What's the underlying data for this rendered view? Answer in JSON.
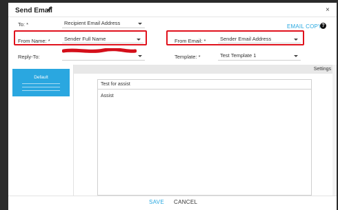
{
  "modal": {
    "title": "Send Email",
    "close_glyph": "×",
    "edit_icon": "pencil-icon"
  },
  "fields": {
    "to": {
      "label": "To: *",
      "value": "Recipient Email Address"
    },
    "from_name": {
      "label": "From Name: *",
      "value": "Sender Full Name"
    },
    "from_email": {
      "label": "From Email: *",
      "value": "Sender Email Address"
    },
    "reply_to": {
      "label": "Reply-To:",
      "value": ""
    },
    "template": {
      "label": "Template: *",
      "value": "Test Template 1"
    }
  },
  "email_copy": {
    "label": "EMAIL COPY",
    "help": "?"
  },
  "templates": [
    {
      "label": "Default"
    }
  ],
  "settings_label": "Settings",
  "editor": {
    "subject": "Test for assist",
    "body": "Assist"
  },
  "footer": {
    "save_label": "SAVE",
    "cancel_label": "CANCEL"
  },
  "colors": {
    "accent": "#28a8e0",
    "highlight_box": "#e0111c",
    "redaction": "#d40f1a",
    "template_card": "#2aa7e0"
  }
}
